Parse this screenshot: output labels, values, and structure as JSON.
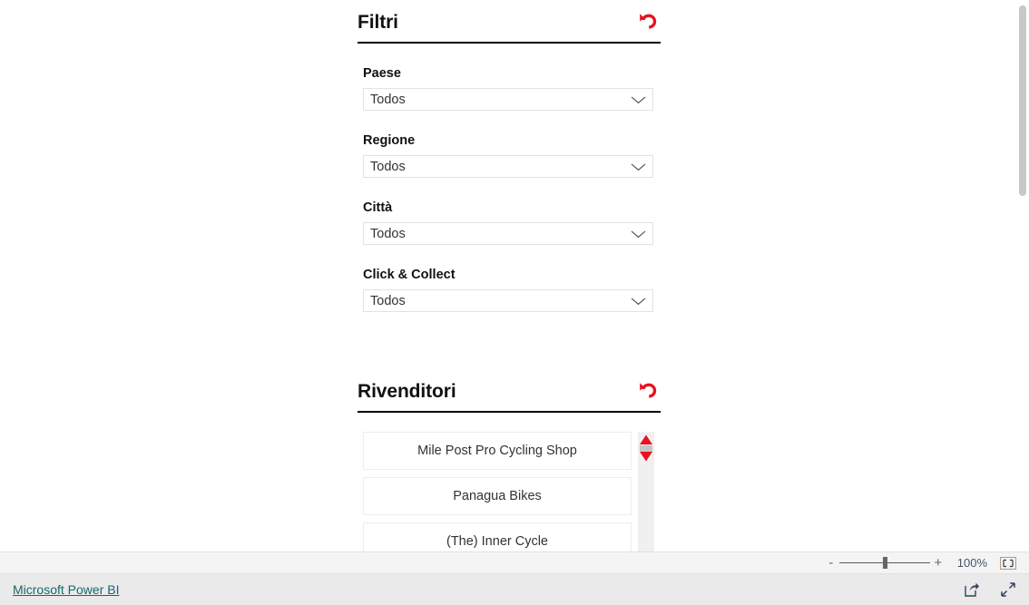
{
  "filters_panel": {
    "title": "Filtri",
    "reset_icon": "undo-arrow-icon",
    "accent_color": "#e81123",
    "fields": [
      {
        "label": "Paese",
        "value": "Todos"
      },
      {
        "label": "Regione",
        "value": "Todos"
      },
      {
        "label": "Città",
        "value": "Todos"
      },
      {
        "label": "Click & Collect",
        "value": "Todos"
      }
    ]
  },
  "retailers_panel": {
    "title": "Rivenditori",
    "reset_icon": "undo-arrow-icon",
    "items": [
      {
        "label": "Mile Post Pro Cycling Shop"
      },
      {
        "label": "Panagua Bikes"
      },
      {
        "label": "(The) Inner Cycle"
      }
    ]
  },
  "status_bar": {
    "zoom_out_label": "-",
    "zoom_in_label": "+",
    "zoom_level": "100%",
    "fit_icon": "fit-to-page-icon"
  },
  "footer": {
    "brand_link": "Microsoft Power BI",
    "share_icon": "share-icon",
    "fullscreen_icon": "fullscreen-expand-icon"
  }
}
